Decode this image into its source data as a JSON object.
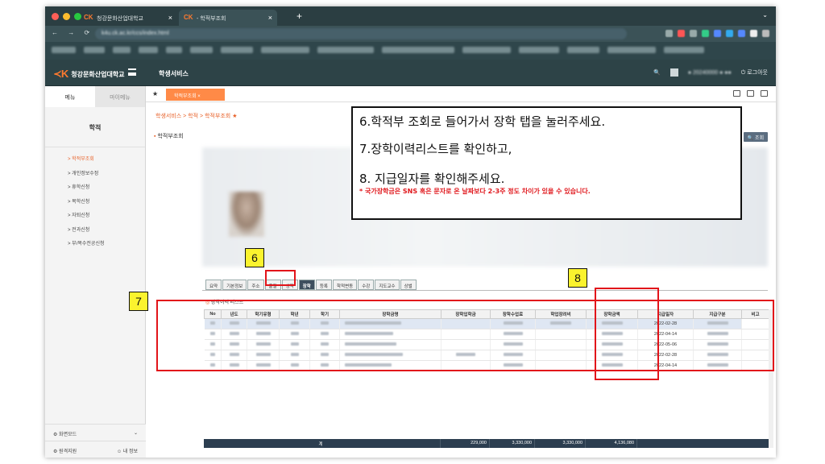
{
  "browser": {
    "tabs": [
      {
        "label": "청강문화산업대학교"
      },
      {
        "label": "- 학적부조회"
      }
    ],
    "address": "k4u.ck.ac.kr/ccs/index.html"
  },
  "header": {
    "school": "청강문화산업대학교",
    "service": "학생서비스",
    "logout": "로그아웃"
  },
  "sidebar": {
    "tabs": [
      "메뉴",
      "마이메뉴"
    ],
    "title": "학적",
    "items": [
      {
        "label": "> 학적부조회"
      },
      {
        "label": "> 개인정보수정"
      },
      {
        "label": "> 휴학신청"
      },
      {
        "label": "> 복학신청"
      },
      {
        "label": "> 자퇴신청"
      },
      {
        "label": "> 전과신청"
      },
      {
        "label": "> 부/복수전공신청"
      }
    ],
    "footer": {
      "screen_mode": "화면모드",
      "remote_support": "원격지원",
      "my_info": "내 정보"
    }
  },
  "content": {
    "open_tab": "학적부조회",
    "breadcrumb": "학생서비스 > 학적 > 학적부조회",
    "page_title": "학적부조회",
    "search_button": "조회",
    "info_tabs": [
      "요약",
      "기본정보",
      "주소",
      "출결",
      "성적",
      "장학",
      "등록",
      "학적변동",
      "수강",
      "지도교수",
      "상벌"
    ],
    "active_tab": "장학",
    "section_label": "장학이력 리스트",
    "columns": [
      "No",
      "년도",
      "학기유형",
      "학년",
      "학기",
      "장학금명",
      "장학입학금",
      "장학수업료",
      "학업장려비",
      "장학금액",
      "지급일자",
      "지급구분",
      "비고"
    ],
    "rows": [
      {
        "date": "2022-02-28"
      },
      {
        "date": "2022-04-14"
      },
      {
        "date": "2022-05-06"
      },
      {
        "date": "2022-02-28"
      },
      {
        "date": "2022-04-14"
      }
    ],
    "totals": {
      "label": "계",
      "entrance": "229,000",
      "tuition": "3,330,000",
      "study": "3,330,000",
      "amount": "4,136,080"
    }
  },
  "annotation": {
    "line1": "6.학적부 조회로 들어가서 장학 탭을 눌러주세요.",
    "line2": "7.장학이력리스트를 확인하고,",
    "line3": "8. 지급일자를 확인해주세요.",
    "note": "* 국가장학금은 SNS 혹은 문자로 온 날짜보다 2-3주 정도 차이가 있을 수 있습니다.",
    "badges": [
      "6",
      "7",
      "8"
    ]
  },
  "colors": {
    "accent": "#e8622a",
    "header_bg": "#2d4347",
    "highlight_red": "#e2141a",
    "badge_yellow": "#fbf32e"
  }
}
